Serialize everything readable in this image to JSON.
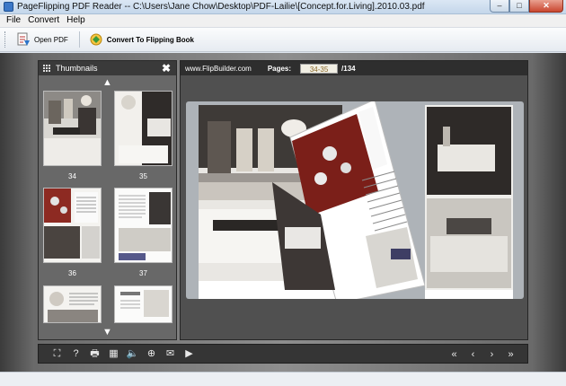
{
  "window": {
    "title": "PageFlipping PDF Reader -- C:\\Users\\Jane Chow\\Desktop\\PDF-Lailie\\[Concept.for.Living].2010.03.pdf",
    "minimize_glyph": "–",
    "maximize_glyph": "□",
    "close_glyph": "✕"
  },
  "menu": {
    "items": [
      "File",
      "Convert",
      "Help"
    ]
  },
  "toolbar": {
    "open_label": "Open PDF",
    "convert_label": "Convert To Flipping Book"
  },
  "thumbnails": {
    "title": "Thumbnails",
    "close_glyph": "✖",
    "up_glyph": "▲",
    "down_glyph": "▼",
    "pages": [
      "34",
      "35",
      "36",
      "37"
    ]
  },
  "viewer": {
    "site": "www.FlipBuilder.com",
    "pages_label": "Pages:",
    "current_pages": "34-35",
    "total_pages": "/134",
    "prev_side_glyph": "◀",
    "next_side_glyph": "▶"
  },
  "controls": {
    "fit_glyph": "⛶",
    "help_glyph": "?",
    "print_glyph": "🖶",
    "grid_glyph": "▦",
    "sound_glyph": "🔈",
    "zoom_glyph": "⊕",
    "mail_glyph": "✉",
    "play_glyph": "▶",
    "first_glyph": "«",
    "prev_glyph": "‹",
    "next_glyph": "›",
    "last_glyph": "»"
  },
  "colors": {
    "accent_title": "#c4d6ea",
    "close_button": "#c9462f",
    "pages_input_text": "#8c6a2c"
  }
}
